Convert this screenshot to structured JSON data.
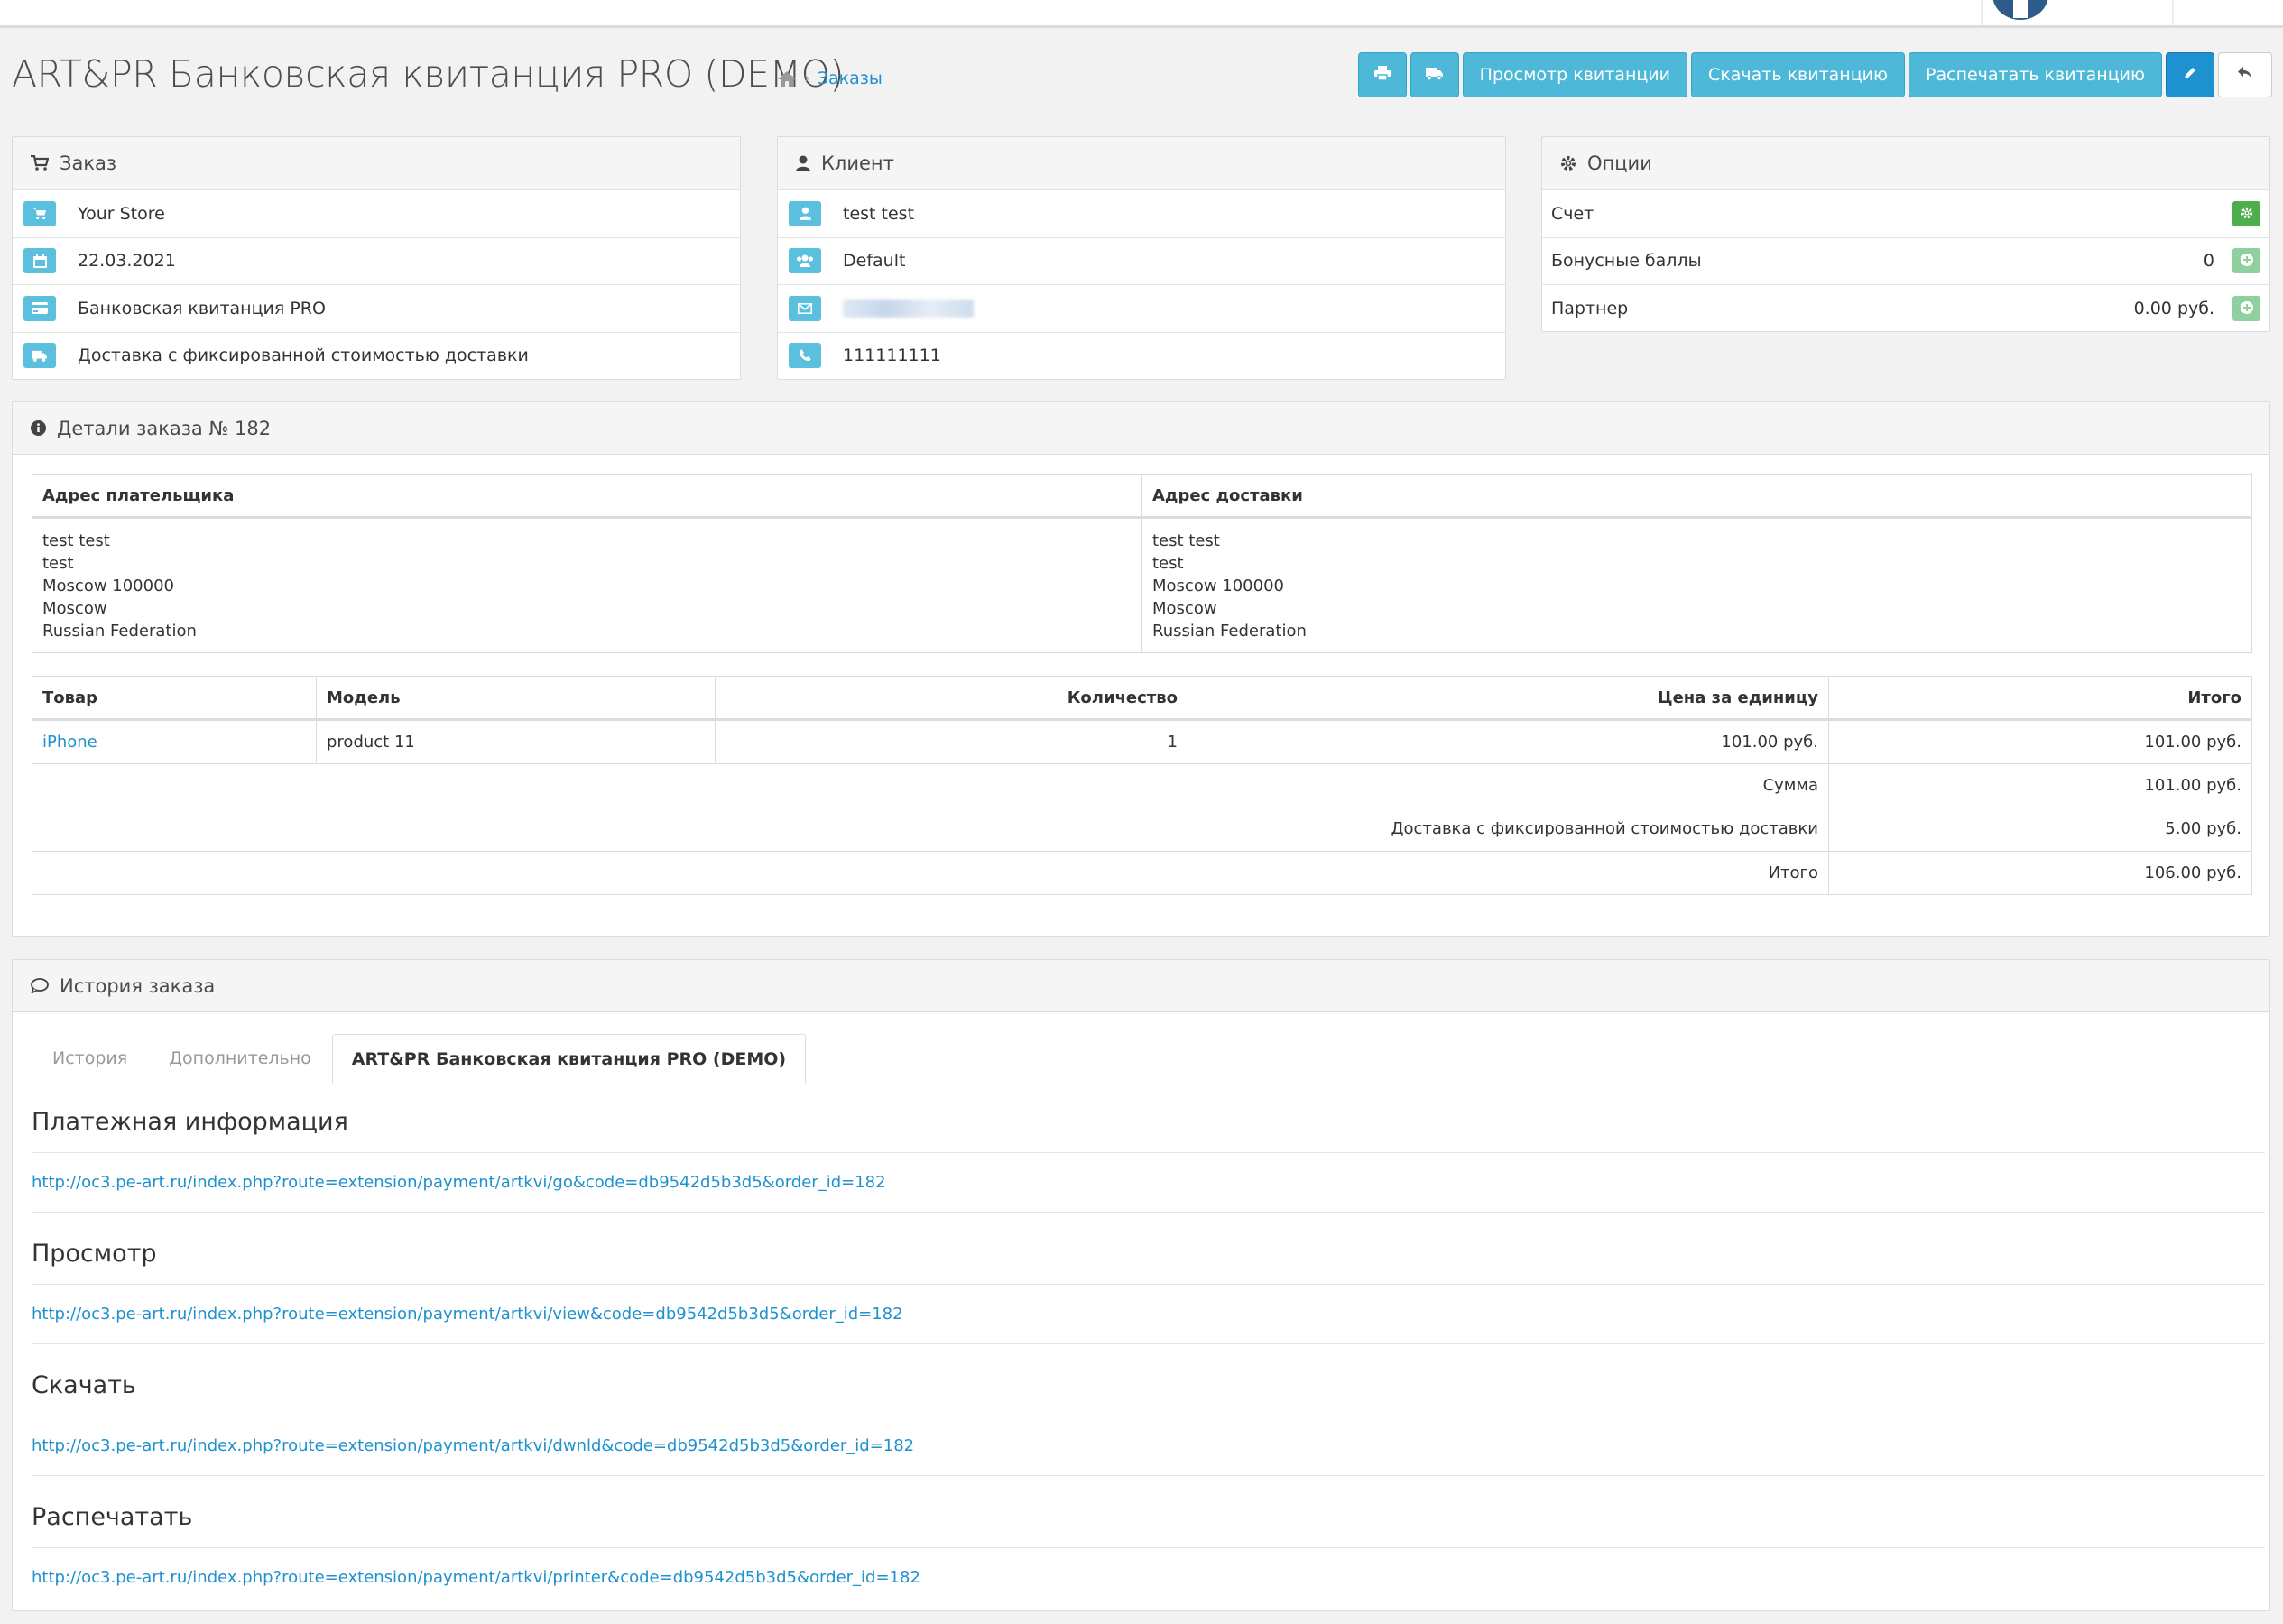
{
  "page": {
    "title": "ART&PR Банковская квитанция PRO (DEMO)",
    "breadcrumb": {
      "current": "Заказы"
    }
  },
  "actions": {
    "view_receipt": "Просмотр квитанции",
    "download_receipt": "Скачать квитанцию",
    "print_receipt": "Распечатать квитанцию"
  },
  "order_panel": {
    "title": "Заказ",
    "store": "Your Store",
    "date": "22.03.2021",
    "payment_method": "Банковская квитанция PRO",
    "shipping_method": "Доставка с фиксированной стоимостью доставки"
  },
  "customer_panel": {
    "title": "Клиент",
    "name": "test test",
    "group": "Default",
    "phone": "111111111"
  },
  "options_panel": {
    "title": "Опции",
    "invoice_label": "Счет",
    "reward_label": "Бонусные баллы",
    "reward_value": "0",
    "affiliate_label": "Партнер",
    "affiliate_value": "0.00 руб."
  },
  "details": {
    "title": "Детали заказа № 182",
    "payment_address_header": "Адрес плательщика",
    "shipping_address_header": "Адрес доставки",
    "payment_address": [
      "test test",
      "test",
      "Moscow 100000",
      "Moscow",
      "Russian Federation"
    ],
    "shipping_address": [
      "test test",
      "test",
      "Moscow 100000",
      "Moscow",
      "Russian Federation"
    ],
    "columns": {
      "product": "Товар",
      "model": "Модель",
      "quantity": "Количество",
      "unit_price": "Цена за единицу",
      "total": "Итого"
    },
    "items": [
      {
        "product": "iPhone",
        "model": "product 11",
        "quantity": "1",
        "unit_price": "101.00 руб.",
        "total": "101.00 руб."
      }
    ],
    "totals": [
      {
        "label": "Сумма",
        "value": "101.00 руб."
      },
      {
        "label": "Доставка с фиксированной стоимостью доставки",
        "value": "5.00 руб."
      },
      {
        "label": "Итого",
        "value": "106.00 руб."
      }
    ]
  },
  "history": {
    "title": "История заказа",
    "tabs": [
      "История",
      "Дополнительно",
      "ART&PR Банковская квитанция PRO (DEMO)"
    ],
    "sections": [
      {
        "heading": "Платежная информация",
        "url": "http://oc3.pe-art.ru/index.php?route=extension/payment/artkvi/go&code=db9542d5b3d5&order_id=182"
      },
      {
        "heading": "Просмотр",
        "url": "http://oc3.pe-art.ru/index.php?route=extension/payment/artkvi/view&code=db9542d5b3d5&order_id=182"
      },
      {
        "heading": "Скачать",
        "url": "http://oc3.pe-art.ru/index.php?route=extension/payment/artkvi/dwnld&code=db9542d5b3d5&order_id=182"
      },
      {
        "heading": "Распечатать",
        "url": "http://oc3.pe-art.ru/index.php?route=extension/payment/artkvi/printer&code=db9542d5b3d5&order_id=182"
      }
    ]
  }
}
